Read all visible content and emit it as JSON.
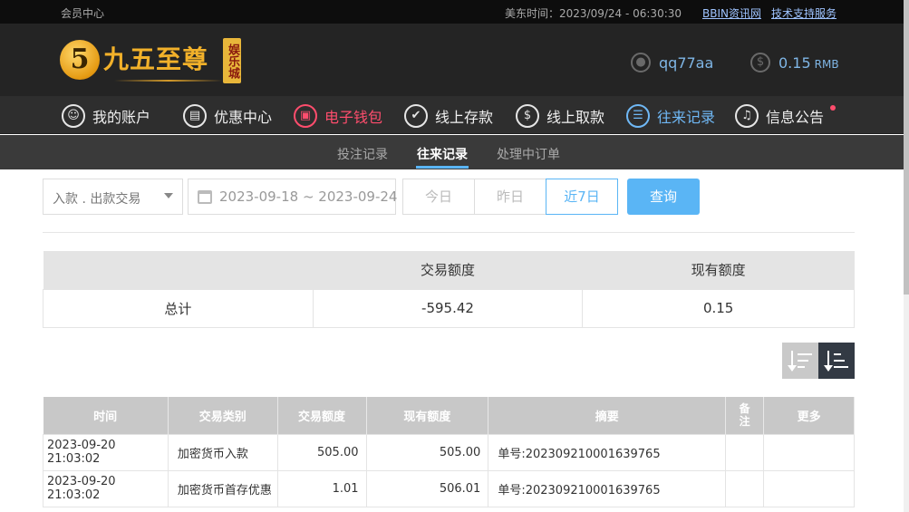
{
  "topbar": {
    "member_center": "会员中心",
    "time_label": "美东时间：2023/09/24 - 06:30:30",
    "link1": "BBIN资讯网",
    "link2": "技术支持服务"
  },
  "logo": {
    "number": "5",
    "name": "九五至尊",
    "badge": "娱乐城"
  },
  "account": {
    "username": "qq77aa",
    "balance": "0.15",
    "unit": "RMB"
  },
  "nav": {
    "items": [
      {
        "label": "我的账户",
        "icon": "user-icon"
      },
      {
        "label": "优惠中心",
        "icon": "gift-icon"
      },
      {
        "label": "电子钱包",
        "icon": "wallet-icon"
      },
      {
        "label": "线上存款",
        "icon": "deposit-icon"
      },
      {
        "label": "线上取款",
        "icon": "withdraw-icon"
      },
      {
        "label": "往来记录",
        "icon": "records-icon"
      },
      {
        "label": "信息公告",
        "icon": "bell-icon"
      }
    ]
  },
  "subnav": {
    "items": [
      "投注记录",
      "往来记录",
      "处理中订单"
    ]
  },
  "filter": {
    "type_value": "入款 . 出款交易",
    "date_range": "2023-09-18 ~ 2023-09-24",
    "quick": [
      "今日",
      "昨日",
      "近7日"
    ],
    "search": "查询"
  },
  "summary": {
    "headers": [
      "",
      "交易额度",
      "现有额度"
    ],
    "row": [
      "总计",
      "-595.42",
      "0.15"
    ]
  },
  "table": {
    "headers": [
      "时间",
      "交易类别",
      "交易额度",
      "现有额度",
      "摘要",
      "备注",
      "更多"
    ],
    "rows": [
      [
        "2023-09-20 21:03:02",
        "加密货币入款",
        "505.00",
        "505.00",
        "单号:202309210001639765",
        "",
        ""
      ],
      [
        "2023-09-20 21:03:02",
        "加密货币首存优惠",
        "1.01",
        "506.01",
        "单号:202309210001639765",
        "",
        ""
      ]
    ]
  },
  "colors": {
    "accent_blue": "#5ab5f5",
    "accent_red": "#ff4d6d",
    "header_bg": "#242424"
  }
}
